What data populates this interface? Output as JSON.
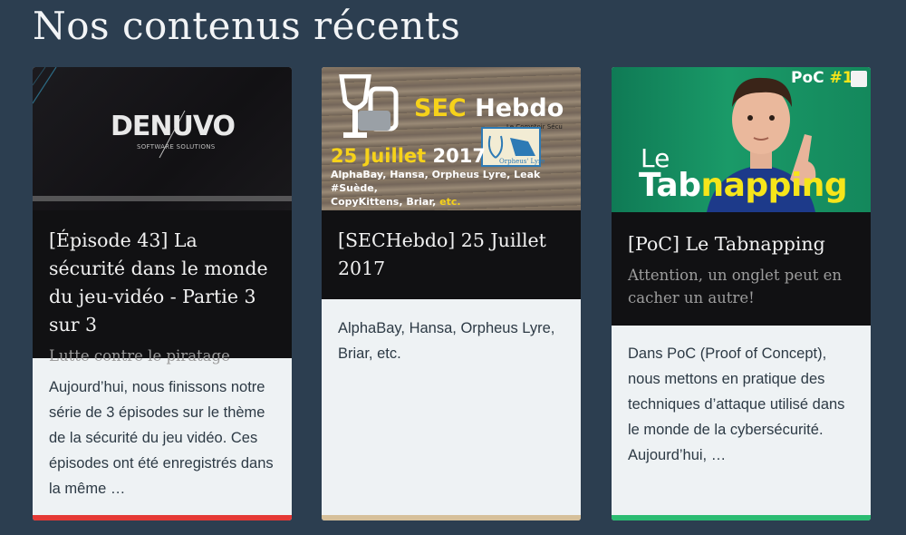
{
  "section": {
    "title": "Nos contenus récents"
  },
  "cards": [
    {
      "thumbnail": {
        "logo_text": "DENUVO",
        "logo_tagline": "SOFTWARE SOLUTIONS"
      },
      "title": "[Épisode 43] La sécurité dans le monde du jeu-vidéo - Partie 3 sur 3",
      "subtitle": "Lutte contre le piratage",
      "description": "Aujourd’hui, nous finissons notre série de 3 épisodes sur le thème de la sécurité du jeu vidéo. Ces épisodes ont été enregistrés dans la même …",
      "accent_color": "#e53935"
    },
    {
      "thumbnail": {
        "title_yellow": "SEC",
        "title_white": "Hebdo",
        "tag": "Le Comptoir Sécu",
        "badge": "Orpheus' Lyre",
        "date_yellow": "25 Juillet",
        "date_white": "2017",
        "line1": "AlphaBay, Hansa, Orpheus Lyre, Leak #Suède,",
        "line2": "CopyKittens, Briar,",
        "line2_etc": "etc."
      },
      "title": "[SECHebdo] 25 Juillet 2017",
      "subtitle": "",
      "description": "AlphaBay, Hansa, Orpheus Lyre, Briar, etc.",
      "accent_color": "#d6c09a"
    },
    {
      "thumbnail": {
        "poc_label": "PoC",
        "poc_number": "#1",
        "le": "Le",
        "tab_white": "Tab",
        "tab_yellow": "napping"
      },
      "title": "[PoC] Le Tabnapping",
      "subtitle": "Attention, un onglet peut en cacher un autre!",
      "description": "Dans PoC (Proof of Concept), nous mettons en pratique des techniques d’attaque utilisé dans le monde de la cybersécurité. Aujourd’hui, …",
      "accent_color": "#2bbc72"
    }
  ]
}
